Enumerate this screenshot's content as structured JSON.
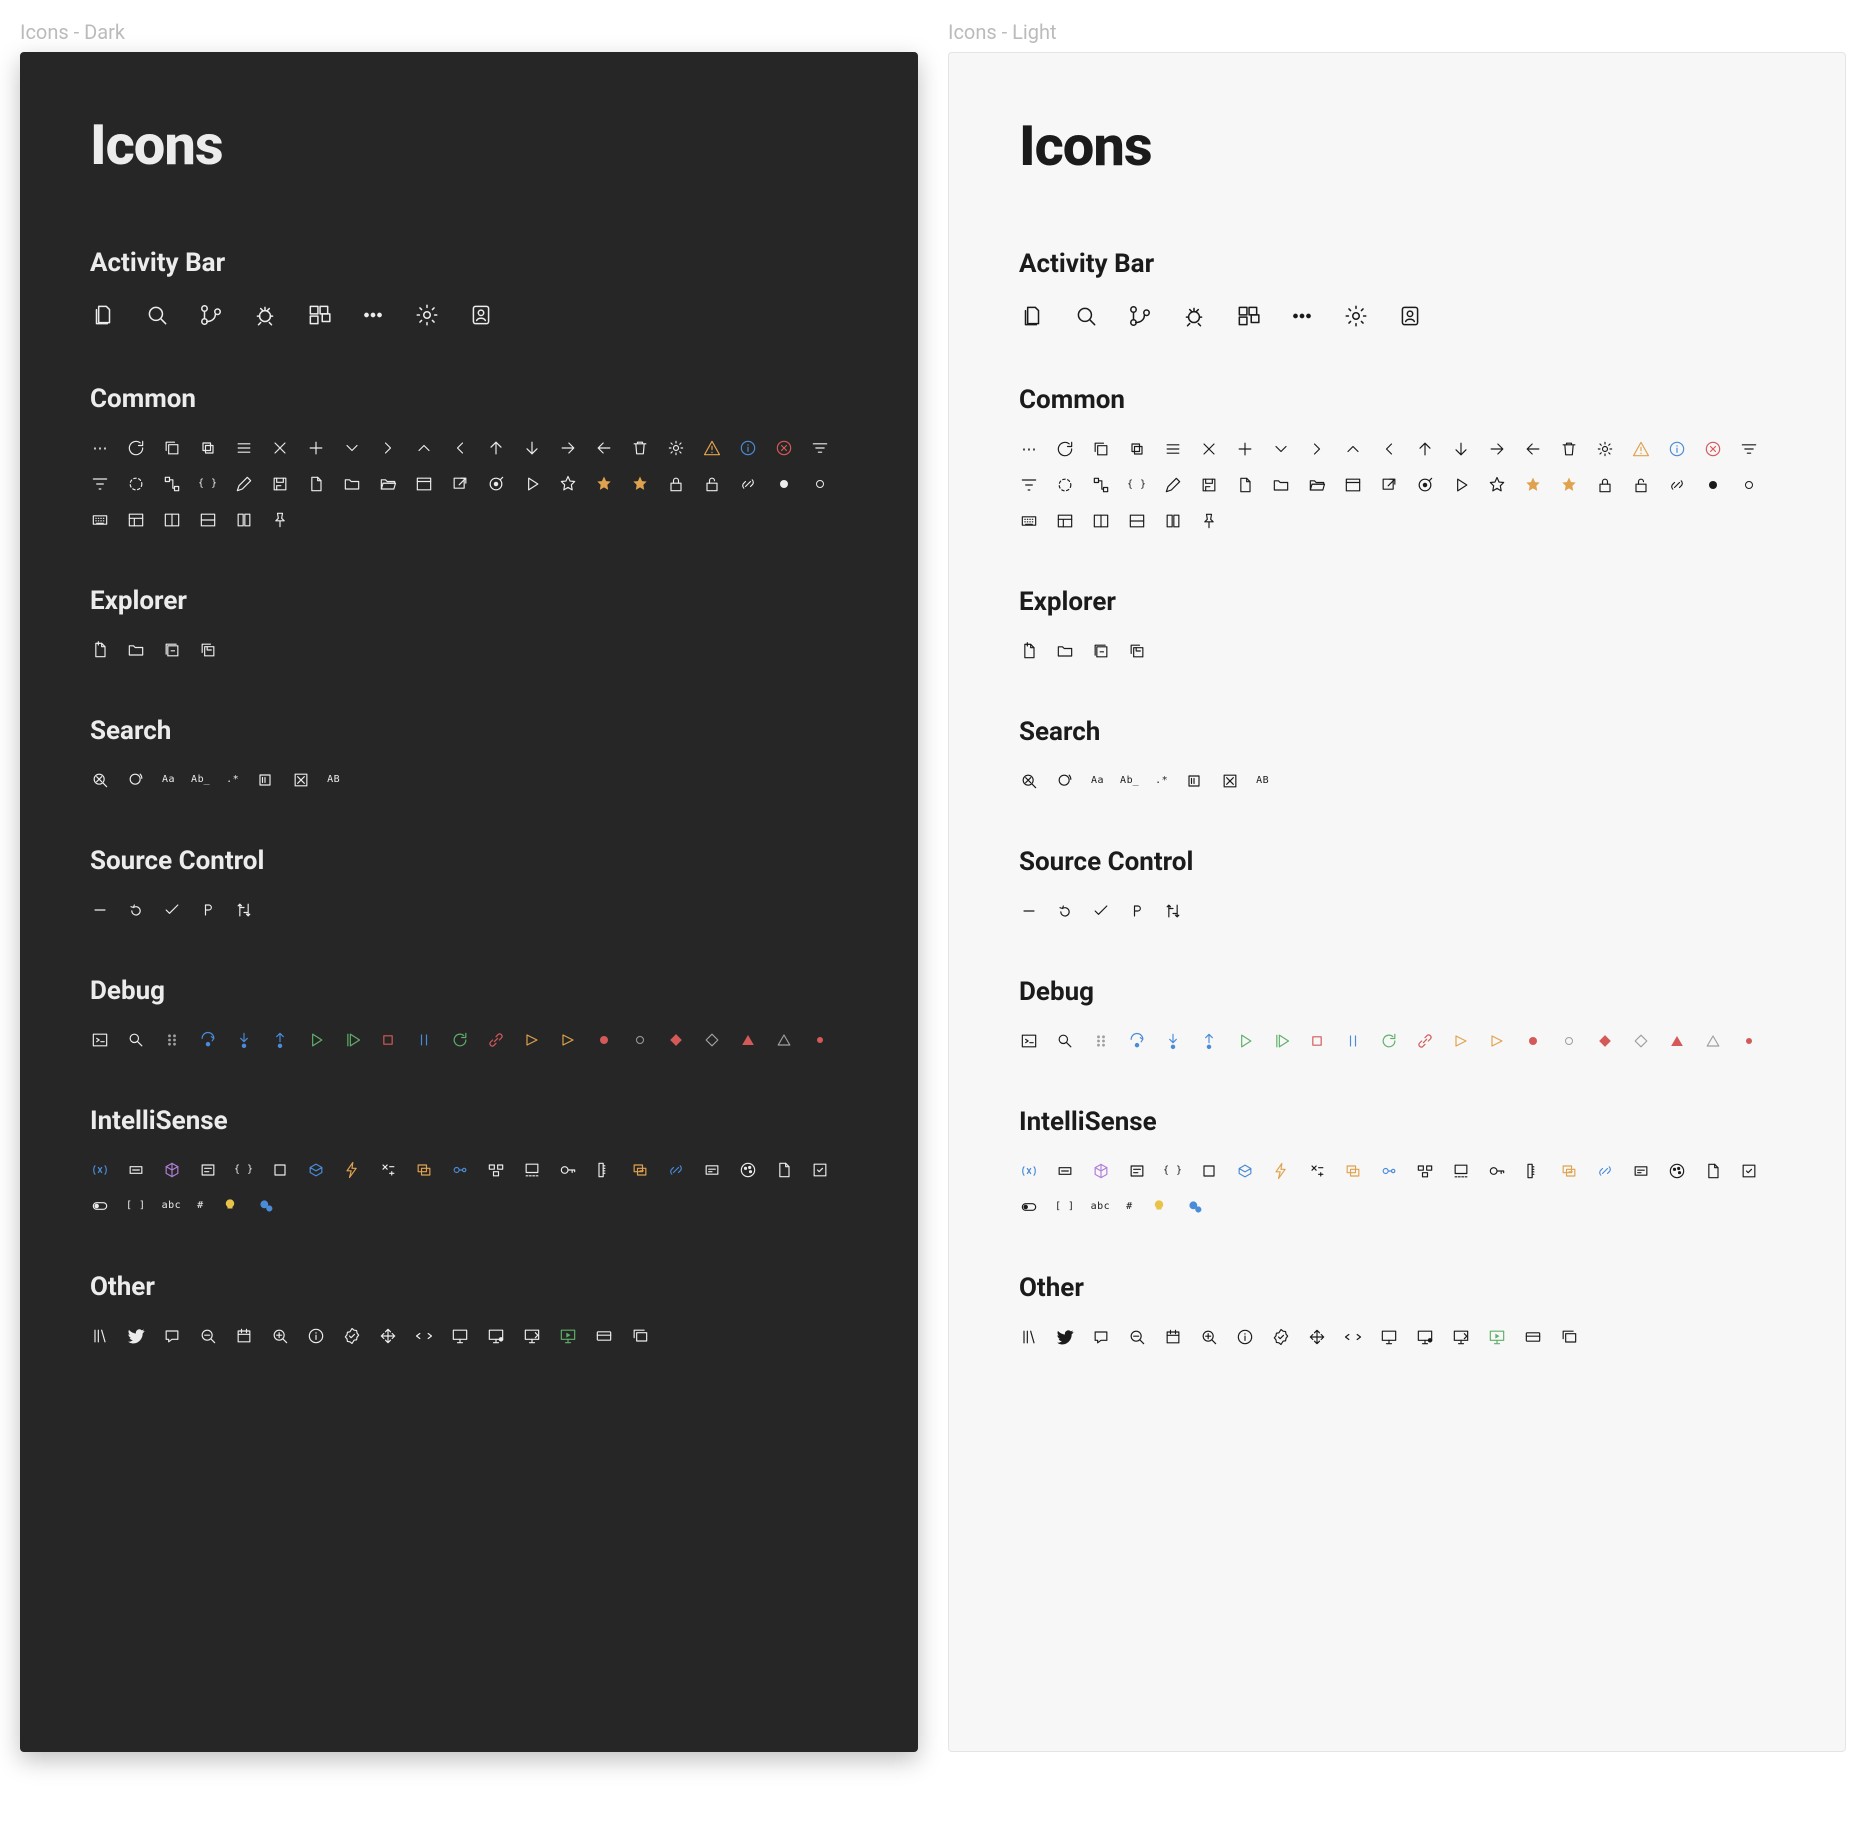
{
  "panels": [
    {
      "key": "dark",
      "label": "Icons - Dark",
      "title": "Icons"
    },
    {
      "key": "light",
      "label": "Icons - Light",
      "title": "Icons"
    }
  ],
  "sections": {
    "activity_bar": {
      "title": "Activity Bar"
    },
    "common": {
      "title": "Common"
    },
    "explorer": {
      "title": "Explorer"
    },
    "search": {
      "title": "Search"
    },
    "source_control": {
      "title": "Source Control"
    },
    "debug": {
      "title": "Debug"
    },
    "intellisense": {
      "title": "IntelliSense"
    },
    "other": {
      "title": "Other"
    }
  },
  "labels": {
    "case_sensitive": "Aa",
    "whole_word": "Ab̲",
    "regex": ".*",
    "replace_all": "AB",
    "abc": "abc",
    "brackets_sq": "[ ]",
    "braces": "{ }",
    "hash": "#"
  },
  "colors": {
    "warning": "#e0a24e",
    "info": "#4a8cd8",
    "error": "#d45a5a",
    "success": "#5fb06a",
    "bulb": "#e8c34a",
    "purple": "#b07fd8"
  }
}
